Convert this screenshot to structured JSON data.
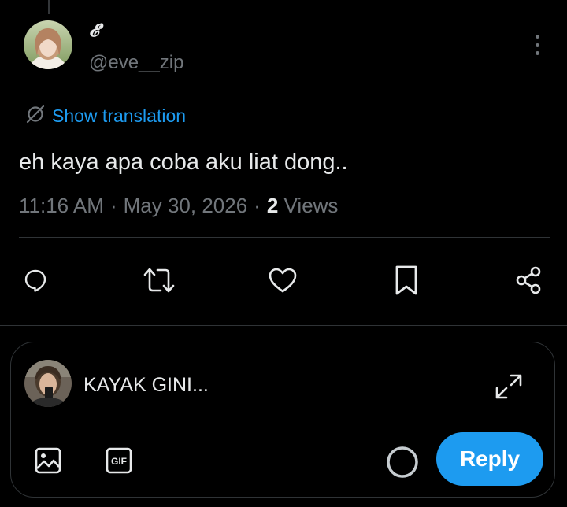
{
  "tweet": {
    "author": {
      "display_name": "𝓔'",
      "handle": "@eve__zip"
    },
    "translate_label": "Show translation",
    "text": "eh kaya apa coba aku liat dong..",
    "time": "11:16 AM",
    "date": "May 30, 2026",
    "separator": "·",
    "views_count": "2",
    "views_label": "Views"
  },
  "actions": [
    "reply-icon",
    "retweet-icon",
    "like-icon",
    "bookmark-icon",
    "share-icon"
  ],
  "composer": {
    "text": "KAYAK GINI...",
    "reply_label": "Reply",
    "media_icons": [
      "image-icon",
      "gif-icon"
    ],
    "gif_label": "GIF"
  },
  "colors": {
    "background": "#000000",
    "accent": "#1d9bf0",
    "text_primary": "#e7e9ea",
    "text_secondary": "#71767b",
    "border": "#2f3336"
  }
}
